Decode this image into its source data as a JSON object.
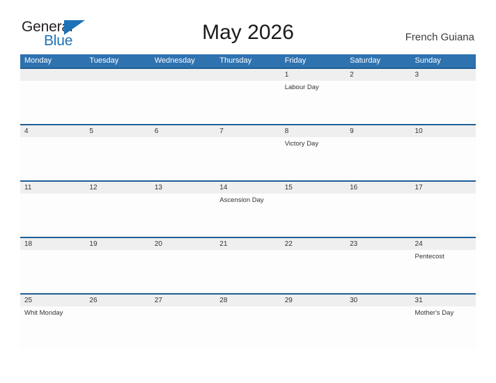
{
  "brand": {
    "name_part1": "General",
    "name_part2": "Blue",
    "flag_icon": "blue-triangle-flag-icon",
    "accent_color": "#1b72b8"
  },
  "header": {
    "title": "May 2026",
    "region": "French Guiana"
  },
  "colors": {
    "header_bar": "#2e72b0",
    "row_divider": "#1f5e96",
    "number_band": "#efefef",
    "cell_background": "#fdfdfd",
    "text": "#333333"
  },
  "calendar": {
    "weekdays": [
      "Monday",
      "Tuesday",
      "Wednesday",
      "Thursday",
      "Friday",
      "Saturday",
      "Sunday"
    ],
    "weeks": [
      {
        "days": [
          {
            "num": "",
            "event": ""
          },
          {
            "num": "",
            "event": ""
          },
          {
            "num": "",
            "event": ""
          },
          {
            "num": "",
            "event": ""
          },
          {
            "num": "1",
            "event": "Labour Day"
          },
          {
            "num": "2",
            "event": ""
          },
          {
            "num": "3",
            "event": ""
          }
        ]
      },
      {
        "days": [
          {
            "num": "4",
            "event": ""
          },
          {
            "num": "5",
            "event": ""
          },
          {
            "num": "6",
            "event": ""
          },
          {
            "num": "7",
            "event": ""
          },
          {
            "num": "8",
            "event": "Victory Day"
          },
          {
            "num": "9",
            "event": ""
          },
          {
            "num": "10",
            "event": ""
          }
        ]
      },
      {
        "days": [
          {
            "num": "11",
            "event": ""
          },
          {
            "num": "12",
            "event": ""
          },
          {
            "num": "13",
            "event": ""
          },
          {
            "num": "14",
            "event": "Ascension Day"
          },
          {
            "num": "15",
            "event": ""
          },
          {
            "num": "16",
            "event": ""
          },
          {
            "num": "17",
            "event": ""
          }
        ]
      },
      {
        "days": [
          {
            "num": "18",
            "event": ""
          },
          {
            "num": "19",
            "event": ""
          },
          {
            "num": "20",
            "event": ""
          },
          {
            "num": "21",
            "event": ""
          },
          {
            "num": "22",
            "event": ""
          },
          {
            "num": "23",
            "event": ""
          },
          {
            "num": "24",
            "event": "Pentecost"
          }
        ]
      },
      {
        "days": [
          {
            "num": "25",
            "event": "Whit Monday"
          },
          {
            "num": "26",
            "event": ""
          },
          {
            "num": "27",
            "event": ""
          },
          {
            "num": "28",
            "event": ""
          },
          {
            "num": "29",
            "event": ""
          },
          {
            "num": "30",
            "event": ""
          },
          {
            "num": "31",
            "event": "Mother's Day"
          }
        ]
      }
    ]
  }
}
